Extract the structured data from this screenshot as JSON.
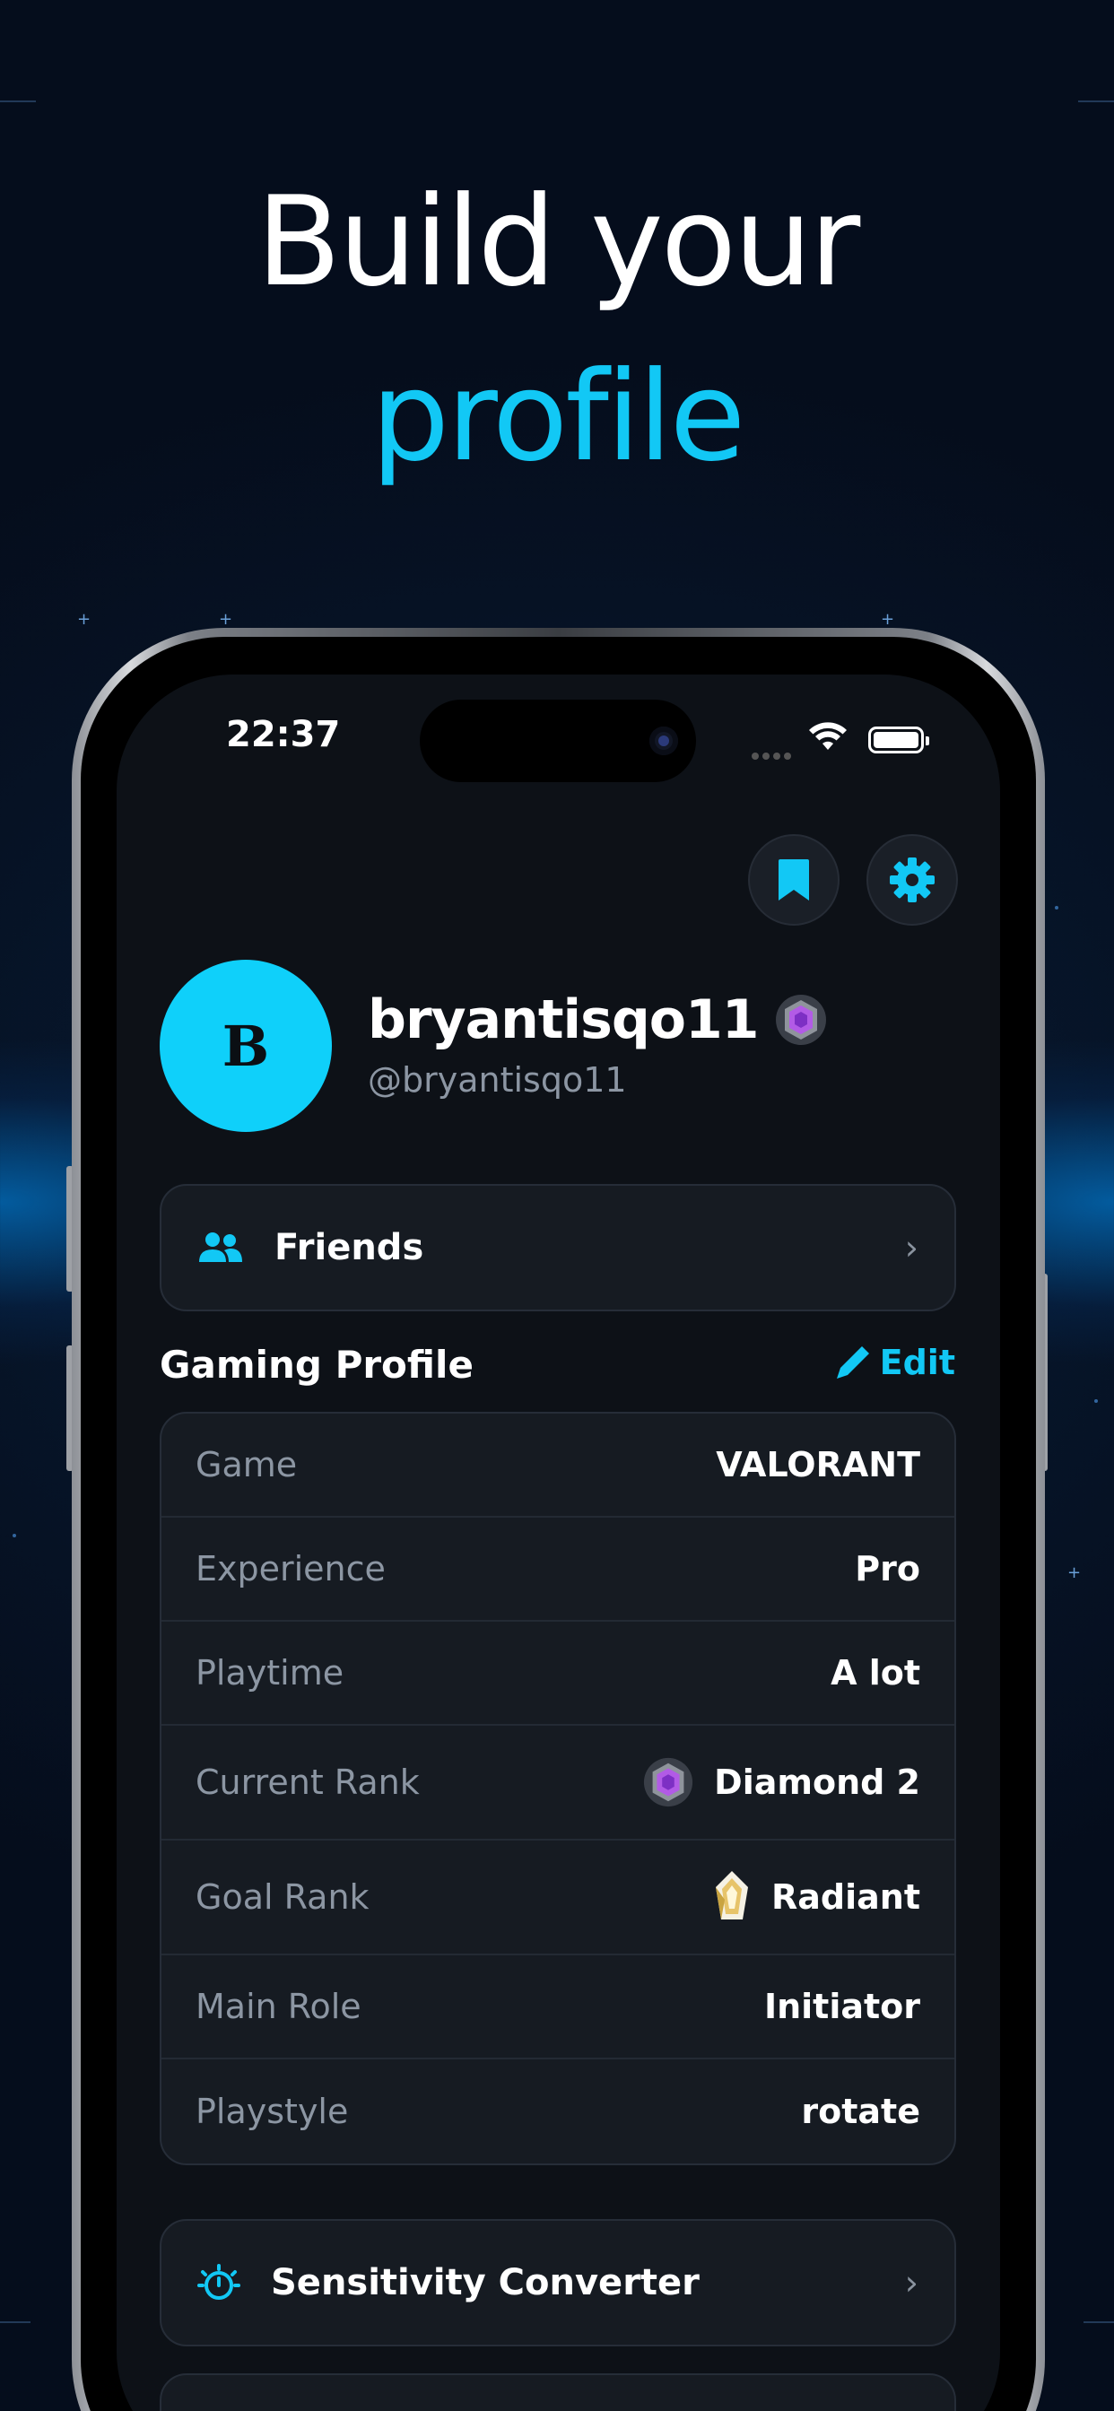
{
  "hero": {
    "line1": "Build your",
    "line2": "profile"
  },
  "status_bar": {
    "time": "22:37"
  },
  "profile": {
    "avatar_letter": "B",
    "username": "bryantisqo11",
    "handle": "@bryantisqo11"
  },
  "friends": {
    "label": "Friends"
  },
  "gaming_profile": {
    "title": "Gaming Profile",
    "edit_label": "Edit",
    "rows": [
      {
        "key": "Game",
        "value": "VALORANT"
      },
      {
        "key": "Experience",
        "value": "Pro"
      },
      {
        "key": "Playtime",
        "value": "A lot"
      },
      {
        "key": "Current Rank",
        "value": "Diamond 2",
        "icon": "diamond-rank-icon"
      },
      {
        "key": "Goal Rank",
        "value": "Radiant",
        "icon": "radiant-rank-icon"
      },
      {
        "key": "Main Role",
        "value": "Initiator"
      },
      {
        "key": "Playstyle",
        "value": "rotate"
      }
    ]
  },
  "sensitivity": {
    "label": "Sensitivity Converter"
  },
  "colors": {
    "accent": "#12c8f5",
    "card": "#161b22",
    "screen": "#0d1117"
  }
}
